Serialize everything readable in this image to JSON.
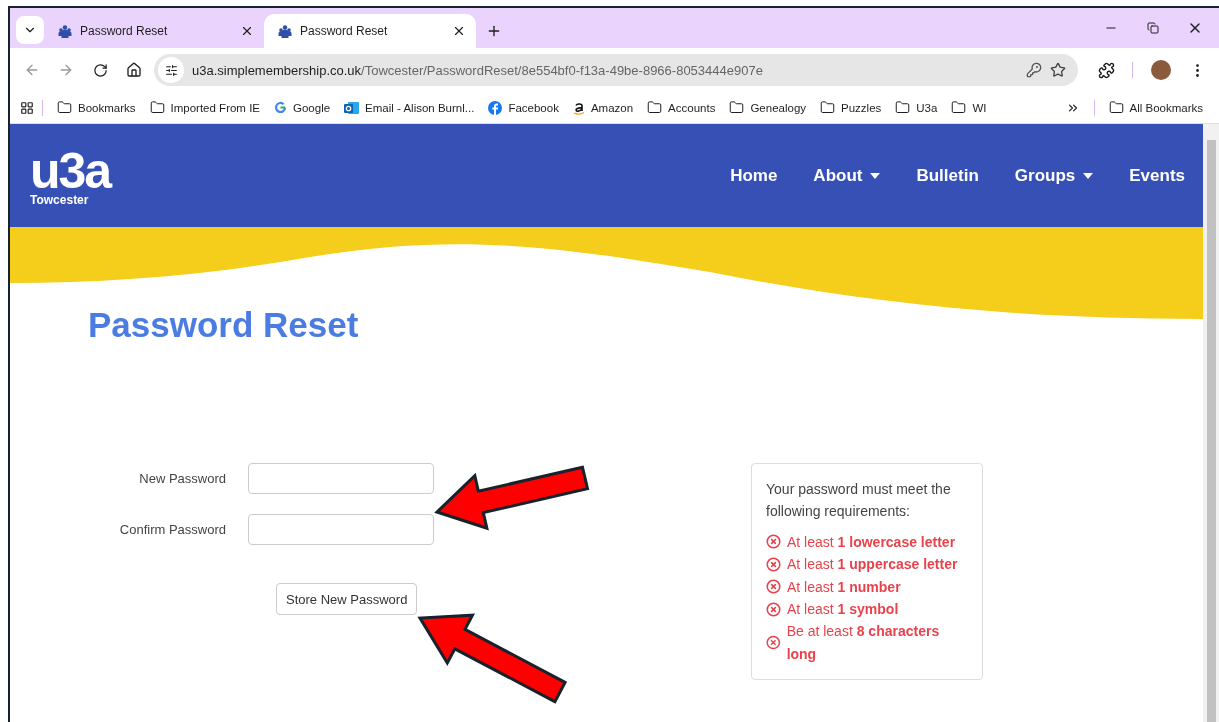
{
  "browser": {
    "tabs": [
      {
        "title": "Password Reset",
        "selected": false
      },
      {
        "title": "Password Reset",
        "selected": true
      }
    ],
    "address": {
      "host": "u3a.simplemembership.co.uk",
      "path": "/Towcester/PasswordReset/8e554bf0-f13a-49be-8966-8053444e907e"
    },
    "bookmarks": [
      {
        "label": "Bookmarks",
        "kind": "folder"
      },
      {
        "label": "Imported From IE",
        "kind": "folder"
      },
      {
        "label": "Google",
        "kind": "google"
      },
      {
        "label": "Email - Alison Burnl...",
        "kind": "outlook"
      },
      {
        "label": "Facebook",
        "kind": "facebook"
      },
      {
        "label": "Amazon",
        "kind": "amazon"
      },
      {
        "label": "Accounts",
        "kind": "folder"
      },
      {
        "label": "Genealogy",
        "kind": "folder"
      },
      {
        "label": "Puzzles",
        "kind": "folder"
      },
      {
        "label": "U3a",
        "kind": "folder"
      },
      {
        "label": "WI",
        "kind": "folder"
      }
    ],
    "all_bookmarks": "All Bookmarks"
  },
  "site": {
    "logo": {
      "mark": "u3a",
      "place": "Towcester"
    },
    "nav": [
      {
        "label": "Home",
        "dropdown": false
      },
      {
        "label": "About",
        "dropdown": true
      },
      {
        "label": "Bulletin",
        "dropdown": false
      },
      {
        "label": "Groups",
        "dropdown": true
      },
      {
        "label": "Events",
        "dropdown": false
      }
    ]
  },
  "page": {
    "title": "Password Reset",
    "fields": [
      {
        "label": "New Password"
      },
      {
        "label": "Confirm Password"
      }
    ],
    "button": "Store New Password",
    "requirements": {
      "intro": "Your password must meet the following requirements:",
      "items": [
        {
          "text": "At least **1 lowercase letter**",
          "met": false
        },
        {
          "text": "At least **1 uppercase letter**",
          "met": false
        },
        {
          "text": "At least **1 number**",
          "met": false
        },
        {
          "text": "At least **1 symbol**",
          "met": false
        },
        {
          "text": "Be at least **8 characters long**",
          "met": false
        }
      ]
    }
  }
}
